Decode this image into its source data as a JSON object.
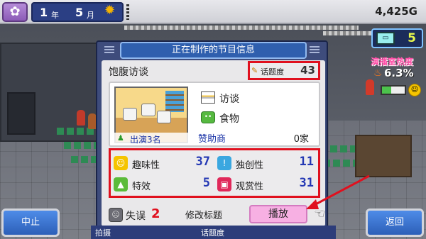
{
  "topbar": {
    "menu_icon": "flower-icon",
    "year_num": "1",
    "year_unit": "年",
    "month_num": "5",
    "month_unit": "月",
    "weather_icon": "sun-icon",
    "money": "4,425G"
  },
  "widgets": {
    "tv_count": "5",
    "heat_label": "演播室热度",
    "heat_value": "6.3%"
  },
  "panel": {
    "header": "正在制作的节目信息",
    "show_title": "饱腹访谈",
    "topic_label": "话题度",
    "topic_value": "43",
    "cast_label": "出演3名",
    "genre": "访谈",
    "subgenre": "食物",
    "sponsor_label": "赞助商",
    "sponsor_value": "0家",
    "stats": [
      {
        "label": "趣味性",
        "value": "37",
        "icon": "smile-icon",
        "color": "#f5c400"
      },
      {
        "label": "独创性",
        "value": "11",
        "icon": "lightbulb-icon",
        "color": "#3aa7e0"
      },
      {
        "label": "特效",
        "value": "5",
        "icon": "tree-icon",
        "color": "#5bbb3a"
      },
      {
        "label": "观赏性",
        "value": "31",
        "icon": "tv-icon",
        "color": "#e0285a"
      }
    ],
    "mistake_label": "失误",
    "mistake_value": "2",
    "rename_label": "修改标题",
    "play_label": "播放"
  },
  "bottom": {
    "stop_label": "中止",
    "back_label": "返回",
    "strip_left": "拍摄",
    "strip_right": "话题度"
  }
}
